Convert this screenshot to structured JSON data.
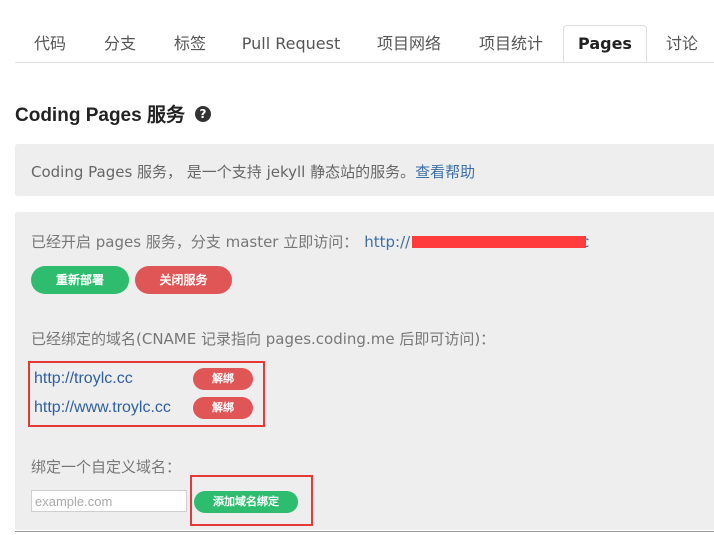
{
  "tabs": [
    {
      "label": "代码"
    },
    {
      "label": "分支"
    },
    {
      "label": "标签"
    },
    {
      "label": "Pull Request"
    },
    {
      "label": "项目网络"
    },
    {
      "label": "项目统计"
    },
    {
      "label": "Pages",
      "active": true
    },
    {
      "label": "讨论"
    }
  ],
  "page_title": "Coding Pages 服务",
  "help_icon": "question-circle-icon",
  "info": {
    "text": "Coding Pages 服务， 是一个支持 jekyll 静态站的服务。",
    "link": "查看帮助"
  },
  "status": {
    "text": "已经开启 pages 服务，分支 master 立即访问：",
    "url_visible": "http://",
    "url_tail": "c"
  },
  "buttons": {
    "redeploy": "重新部署",
    "close_service": "关闭服务"
  },
  "cname_hint": "已经绑定的域名(CNAME 记录指向 pages.coding.me 后即可访问)：",
  "domains": [
    {
      "url": "http://troylc.cc",
      "unbind": "解绑"
    },
    {
      "url": "http://www.troylc.cc",
      "unbind": "解绑"
    }
  ],
  "bind": {
    "label": "绑定一个自定义域名：",
    "placeholder": "example.com",
    "add_button": "添加域名绑定"
  },
  "colors": {
    "green": "#2ebd6f",
    "red": "#e05656",
    "link": "#3b6fa8",
    "highlight": "#e53935"
  }
}
